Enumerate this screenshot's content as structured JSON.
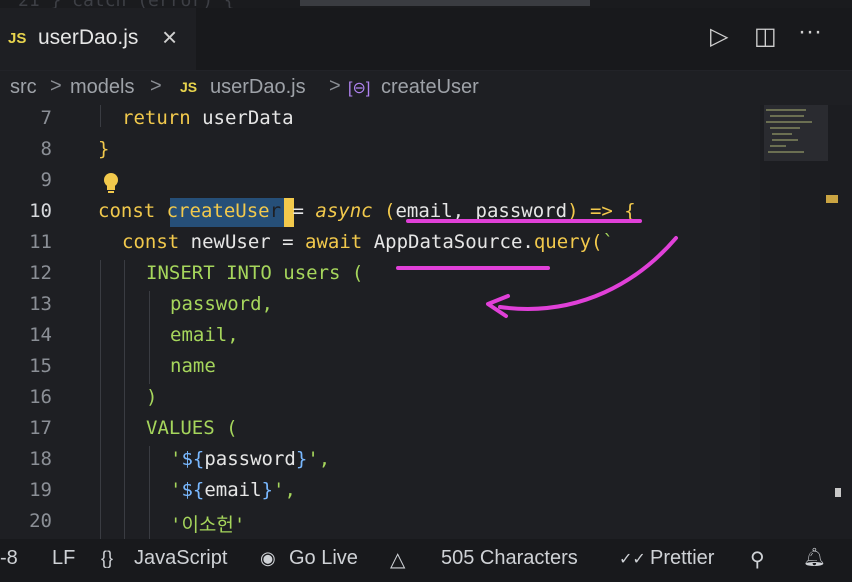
{
  "topstrip": {
    "ghost_text": "21   } catch (error) {"
  },
  "tab": {
    "badge": "JS",
    "label": "userDao.js",
    "close": "×"
  },
  "tab_actions": {
    "run": "▷",
    "split": "◫",
    "more": "···"
  },
  "breadcrumb": {
    "src": "src",
    "models": "models",
    "badge": "JS",
    "file": "userDao.js",
    "symbol_icon": "[⊖]",
    "symbol": "createUser",
    "sep": ">"
  },
  "code_lines": [
    {
      "n": "7"
    },
    {
      "n": "8"
    },
    {
      "n": "9"
    },
    {
      "n": "10"
    },
    {
      "n": "11"
    },
    {
      "n": "12"
    },
    {
      "n": "13"
    },
    {
      "n": "14"
    },
    {
      "n": "15"
    },
    {
      "n": "16"
    },
    {
      "n": "17"
    },
    {
      "n": "18"
    },
    {
      "n": "19"
    },
    {
      "n": "20"
    }
  ],
  "code": {
    "l7_return": "return",
    "l7_var": " userData",
    "l8": "}",
    "l10_const": "const ",
    "l10_fn": "createUse",
    "l10_fn_end": "r",
    "l10_eq": " = ",
    "l10_async": "async",
    "l10_params_open": " (",
    "l10_params": "email, password",
    "l10_params_close": ")",
    "l10_arrow": " => ",
    "l10_brace": "{",
    "l11_const": "const ",
    "l11_var": "newUser",
    "l11_eq": " = ",
    "l11_await": "await",
    "l11_obj": " AppDataSource.",
    "l11_method": "query",
    "l11_paren": "(",
    "l11_tick": "`",
    "l12": "INSERT INTO users (",
    "l13": "password,",
    "l14": "email,",
    "l15": "name",
    "l16": ")",
    "l17": "VALUES (",
    "l18_q1": "'",
    "l18_open": "${",
    "l18_var": "password",
    "l18_close": "}",
    "l18_q2": "',",
    "l19_q1": "'",
    "l19_open": "${",
    "l19_var": "email",
    "l19_close": "}",
    "l19_q2": "',",
    "l20": "'이소헌'"
  },
  "status": {
    "encoding": "-8",
    "eol": "LF",
    "lang_icon": "{}",
    "language": "JavaScript",
    "golive_icon": "◉",
    "golive": "Go Live",
    "chars_icon": "△",
    "chars": "505 Characters",
    "prettier_icon": "✓✓",
    "prettier": "Prettier",
    "account_icon": "⚲",
    "bell_icon": "🔔︎"
  },
  "colors": {
    "annotation": "#e040d8",
    "keyword": "#f2c94c",
    "sql": "#a6d65c",
    "selection": "#264f78"
  }
}
